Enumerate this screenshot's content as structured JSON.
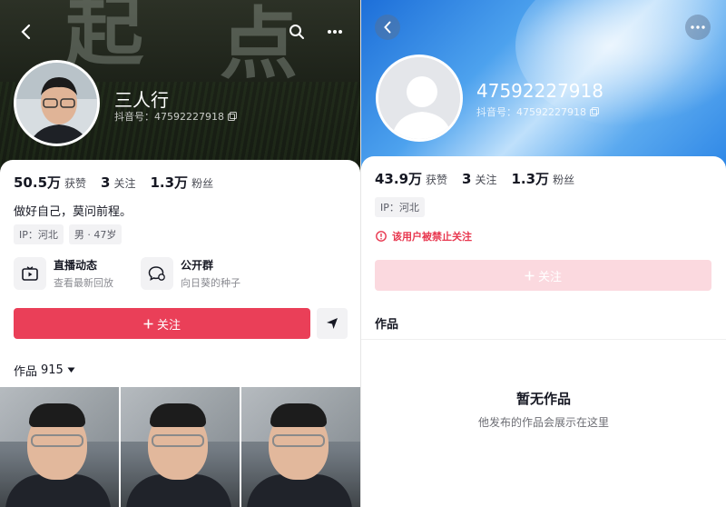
{
  "left": {
    "bg_chars": [
      "起",
      "点"
    ],
    "name": "三人行",
    "douyin_id": "抖音号：47592227918",
    "stats": [
      {
        "num": "50.5万",
        "label": "获赞"
      },
      {
        "num": "3",
        "label": "关注"
      },
      {
        "num": "1.3万",
        "label": "粉丝"
      }
    ],
    "bio": "做好自己，莫问前程。",
    "tags": [
      "IP：河北",
      "男 · 47岁"
    ],
    "features": [
      {
        "title": "直播动态",
        "sub": "查看最新回放"
      },
      {
        "title": "公开群",
        "sub": "向日葵的种子"
      }
    ],
    "follow_label": "关注",
    "works_label": "作品",
    "works_count": "915"
  },
  "right": {
    "name": "47592227918",
    "douyin_id": "抖音号：47592227918",
    "stats": [
      {
        "num": "43.9万",
        "label": "获赞"
      },
      {
        "num": "3",
        "label": "关注"
      },
      {
        "num": "1.3万",
        "label": "粉丝"
      }
    ],
    "tag": "IP：河北",
    "warning": "该用户被禁止关注",
    "follow_label": "关注",
    "works_label": "作品",
    "empty_title": "暂无作品",
    "empty_sub": "他发布的作品会展示在这里"
  },
  "colors": {
    "accent_red": "#ea3f58",
    "disabled_pink": "#fbd9df",
    "warning_red": "#e8374f"
  },
  "icons": [
    "back-icon",
    "search-icon",
    "more-icon",
    "copy-icon",
    "live-tv-icon",
    "group-chat-icon",
    "share-icon",
    "dropdown-arrow-icon",
    "warning-icon",
    "plus-icon"
  ]
}
